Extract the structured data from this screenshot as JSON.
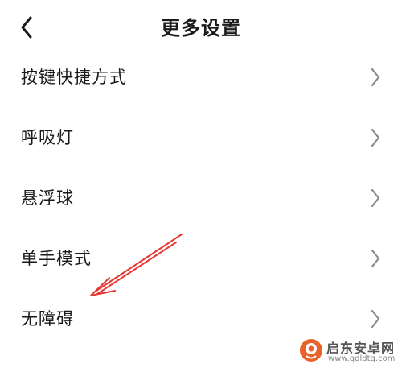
{
  "header": {
    "title": "更多设置",
    "back_icon": "chevron-left-icon"
  },
  "settings": {
    "items": [
      {
        "label": "按键快捷方式",
        "icon": "chevron-right-icon"
      },
      {
        "label": "呼吸灯",
        "icon": "chevron-right-icon"
      },
      {
        "label": "悬浮球",
        "icon": "chevron-right-icon"
      },
      {
        "label": "单手模式",
        "icon": "chevron-right-icon"
      },
      {
        "label": "无障碍",
        "icon": "chevron-right-icon"
      }
    ]
  },
  "annotation": {
    "icon": "red-arrow",
    "color": "#e53935"
  },
  "watermark": {
    "name": "启东安卓网",
    "url": "www.qdldtq.com",
    "logo_color": "#e8622a"
  }
}
